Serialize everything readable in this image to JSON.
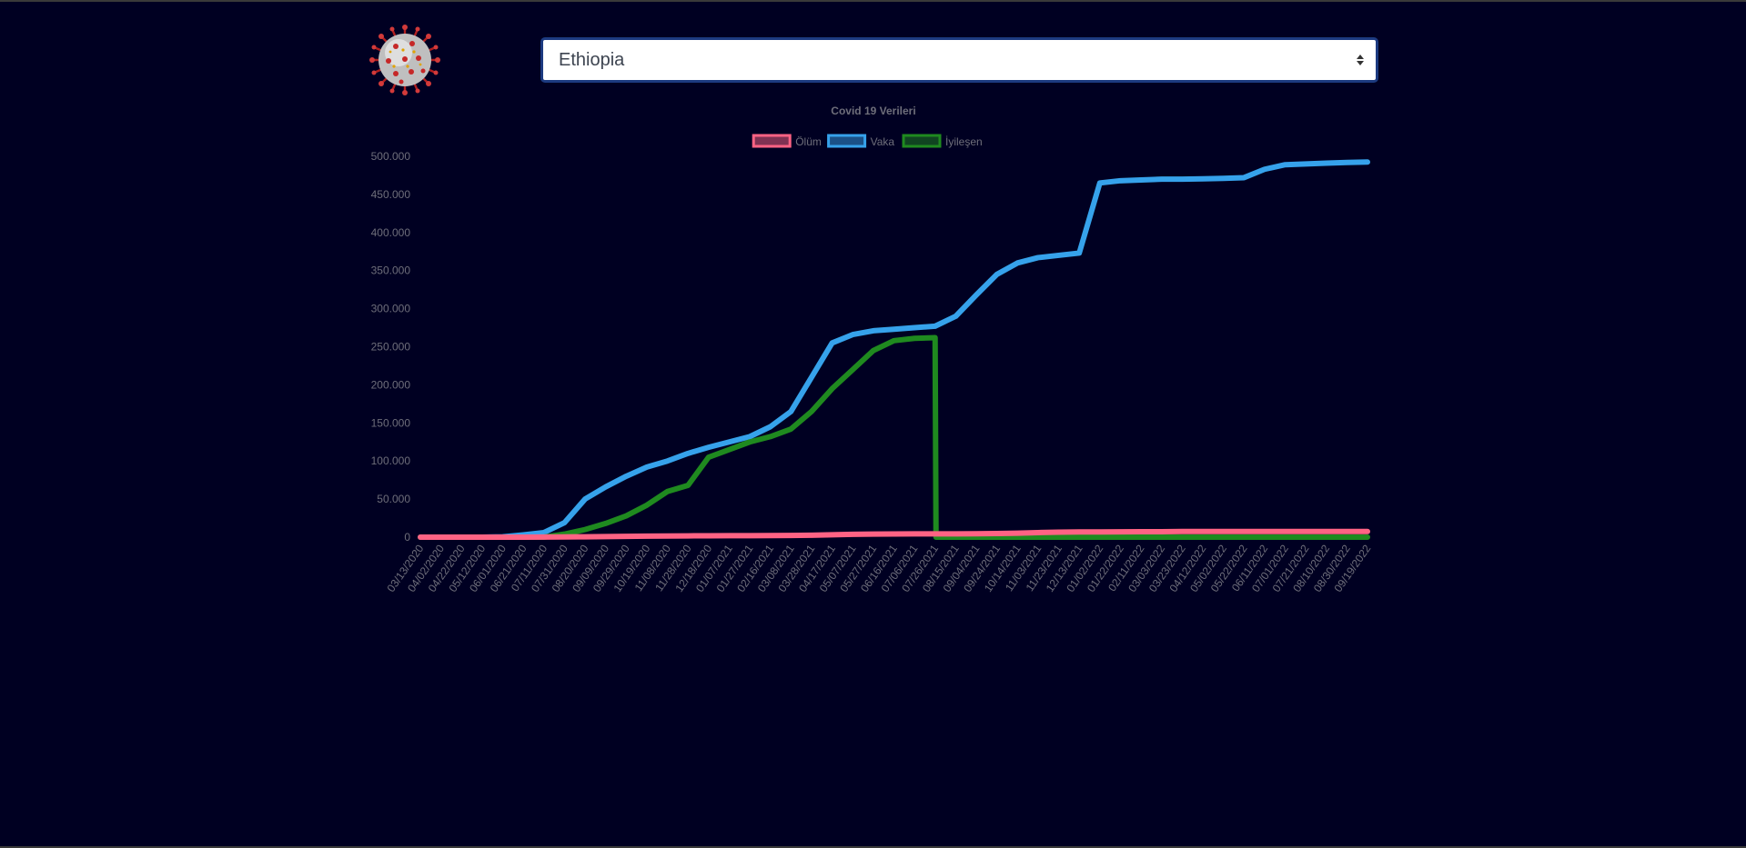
{
  "country_select": {
    "value": "Ethiopia"
  },
  "chart_data": {
    "type": "line",
    "title": "Covid 19 Verileri",
    "xlabel": "",
    "ylabel": "",
    "ylim": [
      0,
      500000
    ],
    "yticks": [
      "0",
      "50.000",
      "100.000",
      "150.000",
      "200.000",
      "250.000",
      "300.000",
      "350.000",
      "400.000",
      "450.000",
      "500.000"
    ],
    "legend_position": "top",
    "x": [
      "03/13/2020",
      "04/02/2020",
      "04/22/2020",
      "05/12/2020",
      "06/01/2020",
      "06/21/2020",
      "07/11/2020",
      "07/31/2020",
      "08/20/2020",
      "09/09/2020",
      "09/29/2020",
      "10/19/2020",
      "11/08/2020",
      "11/28/2020",
      "12/18/2020",
      "01/07/2021",
      "01/27/2021",
      "02/16/2021",
      "03/08/2021",
      "03/28/2021",
      "04/17/2021",
      "05/07/2021",
      "05/27/2021",
      "06/16/2021",
      "07/06/2021",
      "07/26/2021",
      "08/15/2021",
      "09/04/2021",
      "09/24/2021",
      "10/14/2021",
      "11/03/2021",
      "11/23/2021",
      "12/13/2021",
      "01/02/2022",
      "01/22/2022",
      "02/11/2022",
      "03/03/2022",
      "03/23/2022",
      "04/12/2022",
      "05/02/2022",
      "05/22/2022",
      "06/11/2022",
      "07/01/2022",
      "07/21/2022",
      "08/10/2022",
      "08/30/2022",
      "09/19/2022"
    ],
    "series": [
      {
        "name": "Ölüm",
        "color": "#ff6384",
        "values": [
          0,
          0,
          0,
          0,
          0,
          0,
          100,
          300,
          500,
          800,
          1100,
          1300,
          1500,
          1700,
          1800,
          1900,
          2000,
          2100,
          2300,
          2600,
          3100,
          3700,
          4000,
          4200,
          4300,
          4400,
          4400,
          4500,
          4700,
          5200,
          6000,
          6600,
          6800,
          6900,
          7000,
          7100,
          7200,
          7400,
          7500,
          7500,
          7500,
          7500,
          7500,
          7500,
          7500,
          7500,
          7500
        ]
      },
      {
        "name": "Vaka",
        "color": "#36a2eb",
        "values": [
          0,
          0,
          0,
          0,
          400,
          3000,
          6000,
          19000,
          50000,
          66000,
          80000,
          92000,
          100000,
          110000,
          118000,
          125000,
          132000,
          145000,
          165000,
          210000,
          255000,
          266000,
          271000,
          273000,
          275000,
          277000,
          290000,
          318000,
          345000,
          360000,
          367000,
          370000,
          373000,
          465000,
          468000,
          469000,
          470000,
          470000,
          470500,
          471000,
          472000,
          483000,
          489000,
          490000,
          491000,
          492000,
          492500
        ]
      },
      {
        "name": "İyileşen",
        "color": "#1f8a1f",
        "values": [
          0,
          0,
          0,
          0,
          0,
          0,
          0,
          4000,
          10000,
          18000,
          28000,
          42000,
          60000,
          68000,
          105000,
          115000,
          125000,
          132000,
          142000,
          165000,
          195000,
          220000,
          245000,
          258000,
          261000,
          262000,
          0,
          0,
          0,
          0,
          0,
          0,
          0,
          0,
          0,
          0,
          0,
          0,
          0,
          0,
          0,
          0,
          0,
          0,
          0,
          0,
          0
        ]
      }
    ]
  }
}
